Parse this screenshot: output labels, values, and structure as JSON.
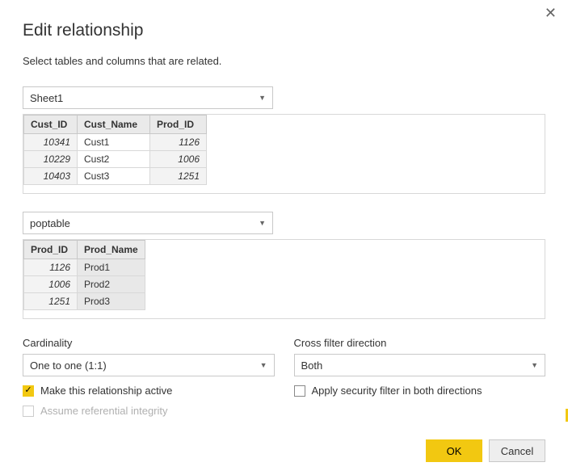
{
  "dialog": {
    "title": "Edit relationship",
    "subtitle": "Select tables and columns that are related."
  },
  "table1": {
    "selected": "Sheet1",
    "columns": [
      "Cust_ID",
      "Cust_Name",
      "Prod_ID"
    ],
    "rows": [
      {
        "Cust_ID": "10341",
        "Cust_Name": "Cust1",
        "Prod_ID": "1126"
      },
      {
        "Cust_ID": "10229",
        "Cust_Name": "Cust2",
        "Prod_ID": "1006"
      },
      {
        "Cust_ID": "10403",
        "Cust_Name": "Cust3",
        "Prod_ID": "1251"
      }
    ]
  },
  "table2": {
    "selected": "poptable",
    "columns": [
      "Prod_ID",
      "Prod_Name"
    ],
    "rows": [
      {
        "Prod_ID": "1126",
        "Prod_Name": "Prod1"
      },
      {
        "Prod_ID": "1006",
        "Prod_Name": "Prod2"
      },
      {
        "Prod_ID": "1251",
        "Prod_Name": "Prod3"
      }
    ]
  },
  "options": {
    "cardinality_label": "Cardinality",
    "cardinality_value": "One to one (1:1)",
    "crossfilter_label": "Cross filter direction",
    "crossfilter_value": "Both",
    "make_active_label": "Make this relationship active",
    "apply_security_label": "Apply security filter in both directions",
    "assume_ref_label": "Assume referential integrity"
  },
  "buttons": {
    "ok": "OK",
    "cancel": "Cancel"
  }
}
